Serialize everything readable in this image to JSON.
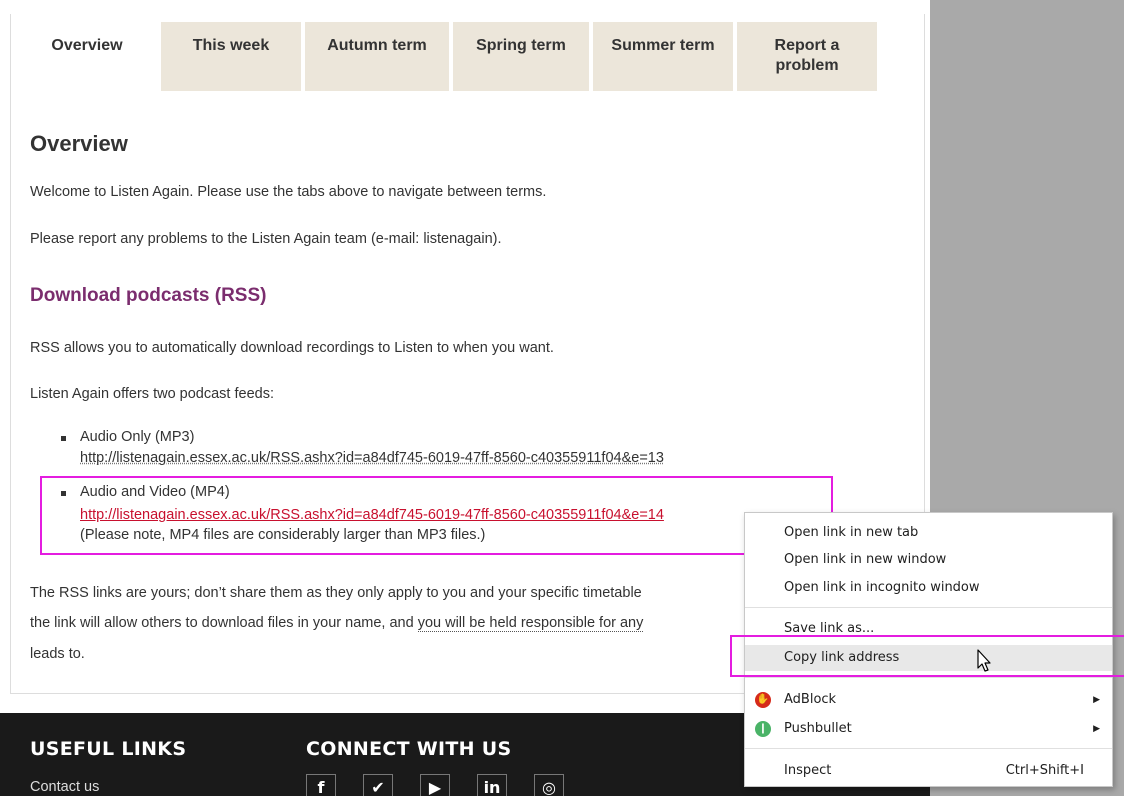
{
  "tabs": [
    "Overview",
    "This week",
    "Autumn term",
    "Spring term",
    "Summer term",
    "Report a problem"
  ],
  "overview": {
    "heading": "Overview",
    "p1": "Welcome to Listen Again. Please use the tabs above to navigate between terms.",
    "p2": "Please report any problems to the Listen Again team (e-mail: listenagain)."
  },
  "rss": {
    "heading": "Download podcasts (RSS)",
    "p1": "RSS allows you to automatically download recordings to Listen to when you want.",
    "p2": "Listen Again offers two podcast feeds:",
    "feeds": [
      {
        "title": "Audio Only (MP3)",
        "url": "http://listenagain.essex.ac.uk/RSS.ashx?id=a84df745-6019-47ff-8560-c40355911f04&e=13"
      },
      {
        "title": "Audio and Video (MP4)",
        "url": "http://listenagain.essex.ac.uk/RSS.ashx?id=a84df745-6019-47ff-8560-c40355911f04&e=14",
        "note": "(Please note, MP4 files are considerably larger than MP3 files.)"
      }
    ],
    "warning_line1": "The RSS links are yours; don’t share them as they only apply to you and your specific timetable",
    "warning_line2_a": "the link will allow others to download files in your name, and ",
    "warning_line2_b": "you will be held responsible for any",
    "warning_line3": "leads to."
  },
  "footer": {
    "useful_links": "USEFUL LINKS",
    "connect": "CONNECT WITH US",
    "contact": "Contact us",
    "social_icons": [
      "facebook-icon",
      "twitter-icon",
      "youtube-icon",
      "linkedin-icon",
      "instagram-icon"
    ]
  },
  "context_menu": {
    "open_new_tab": "Open link in new tab",
    "open_new_window": "Open link in new window",
    "open_incognito": "Open link in incognito window",
    "save_link": "Save link as...",
    "copy_link": "Copy link address",
    "adblock": "AdBlock",
    "pushbullet": "Pushbullet",
    "inspect": "Inspect",
    "inspect_shortcut": "Ctrl+Shift+I"
  },
  "colors": {
    "tab_bg": "#ece6da",
    "heading_purple": "#7b2d6e",
    "link_red": "#c8102e",
    "highlight_magenta": "#e41ce0",
    "footer_bg": "#1a1a1a",
    "adblock_red": "#d62a1a",
    "pushbullet_green": "#4ab367"
  }
}
